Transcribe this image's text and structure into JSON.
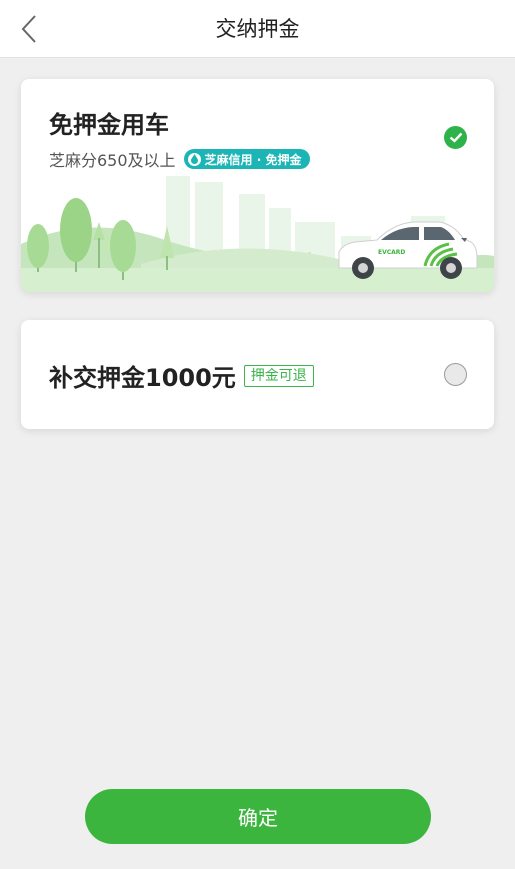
{
  "header": {
    "title": "交纳押金",
    "back_icon": "chevron-left-icon"
  },
  "options": {
    "free_deposit": {
      "title": "免押金用车",
      "subtitle": "芝麻分650及以上",
      "badge": "芝麻信用 · 免押金",
      "badge_color": "#1cb5b5",
      "selected": true
    },
    "pay_deposit": {
      "title": "补交押金1000元",
      "tag": "押金可退",
      "selected": false
    }
  },
  "car_brand": "EVCARD",
  "confirm_label": "确定",
  "colors": {
    "accent": "#3cb53e",
    "check": "#2eb24a",
    "background": "#efefef"
  }
}
